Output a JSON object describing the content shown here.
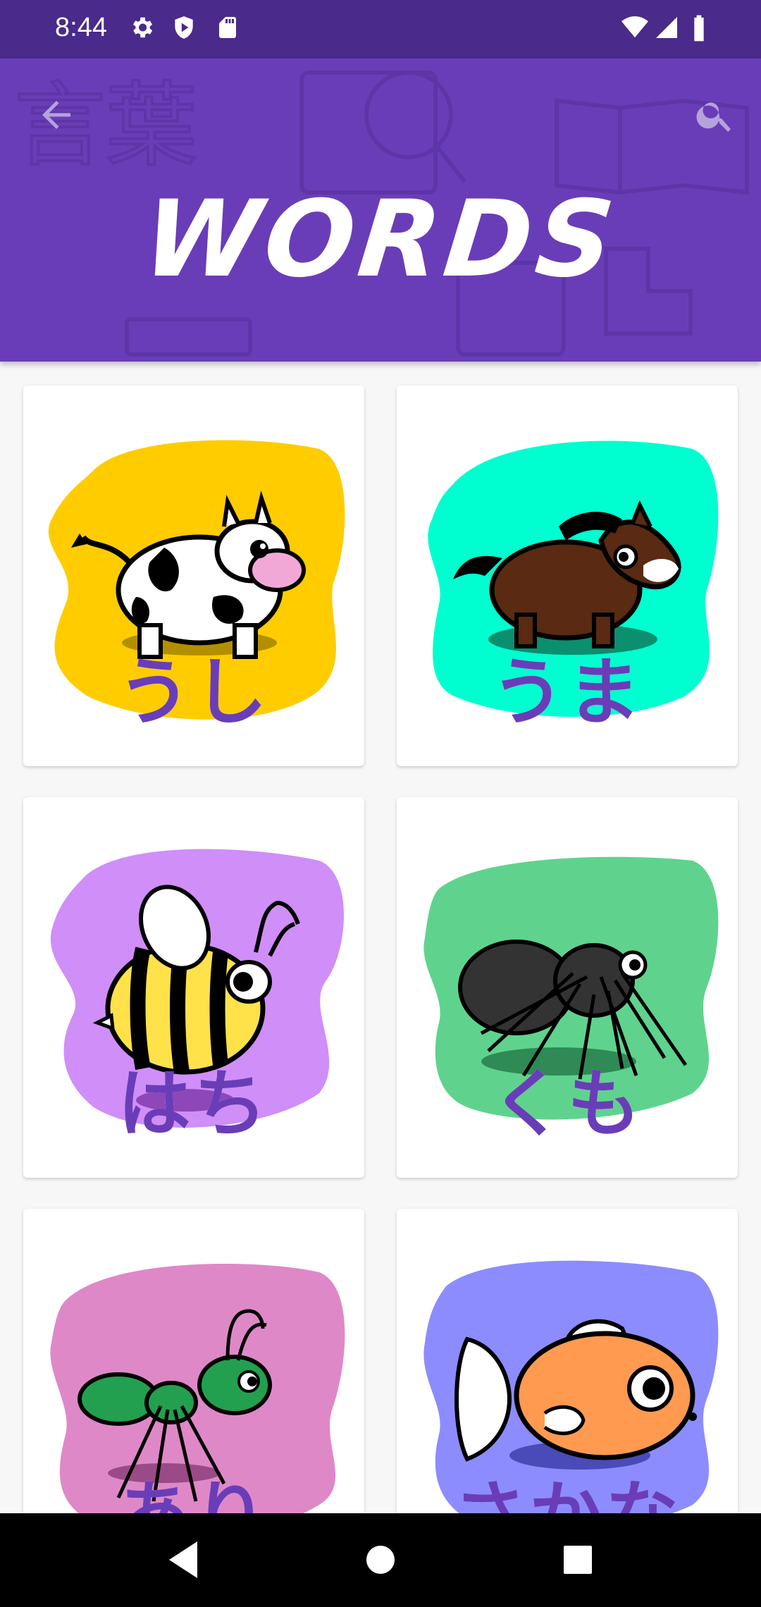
{
  "status_bar": {
    "time": "8:44",
    "icons": [
      "settings-icon",
      "shield-icon",
      "sd-card-icon",
      "wifi-icon",
      "signal-icon",
      "battery-icon"
    ]
  },
  "header": {
    "title": "WORDS",
    "back_icon": "arrow-back-icon",
    "search_icon": "search-icon",
    "color": "#6a3db8"
  },
  "cards": [
    {
      "word": "うし",
      "blob_color": "#ffcc00",
      "picture": "cow"
    },
    {
      "word": "うま",
      "blob_color": "#00ffd0",
      "picture": "horse"
    },
    {
      "word": "はち",
      "blob_color": "#d08ef8",
      "picture": "bee"
    },
    {
      "word": "くも",
      "blob_color": "#5fd38d",
      "picture": "spider"
    },
    {
      "word": "あり",
      "blob_color": "#df88c8",
      "picture": "ant"
    },
    {
      "word": "さかな",
      "blob_color": "#8c8cff",
      "picture": "fish"
    }
  ],
  "nav_bar": {
    "icons": [
      "back-triangle-icon",
      "home-circle-icon",
      "recents-square-icon"
    ]
  }
}
